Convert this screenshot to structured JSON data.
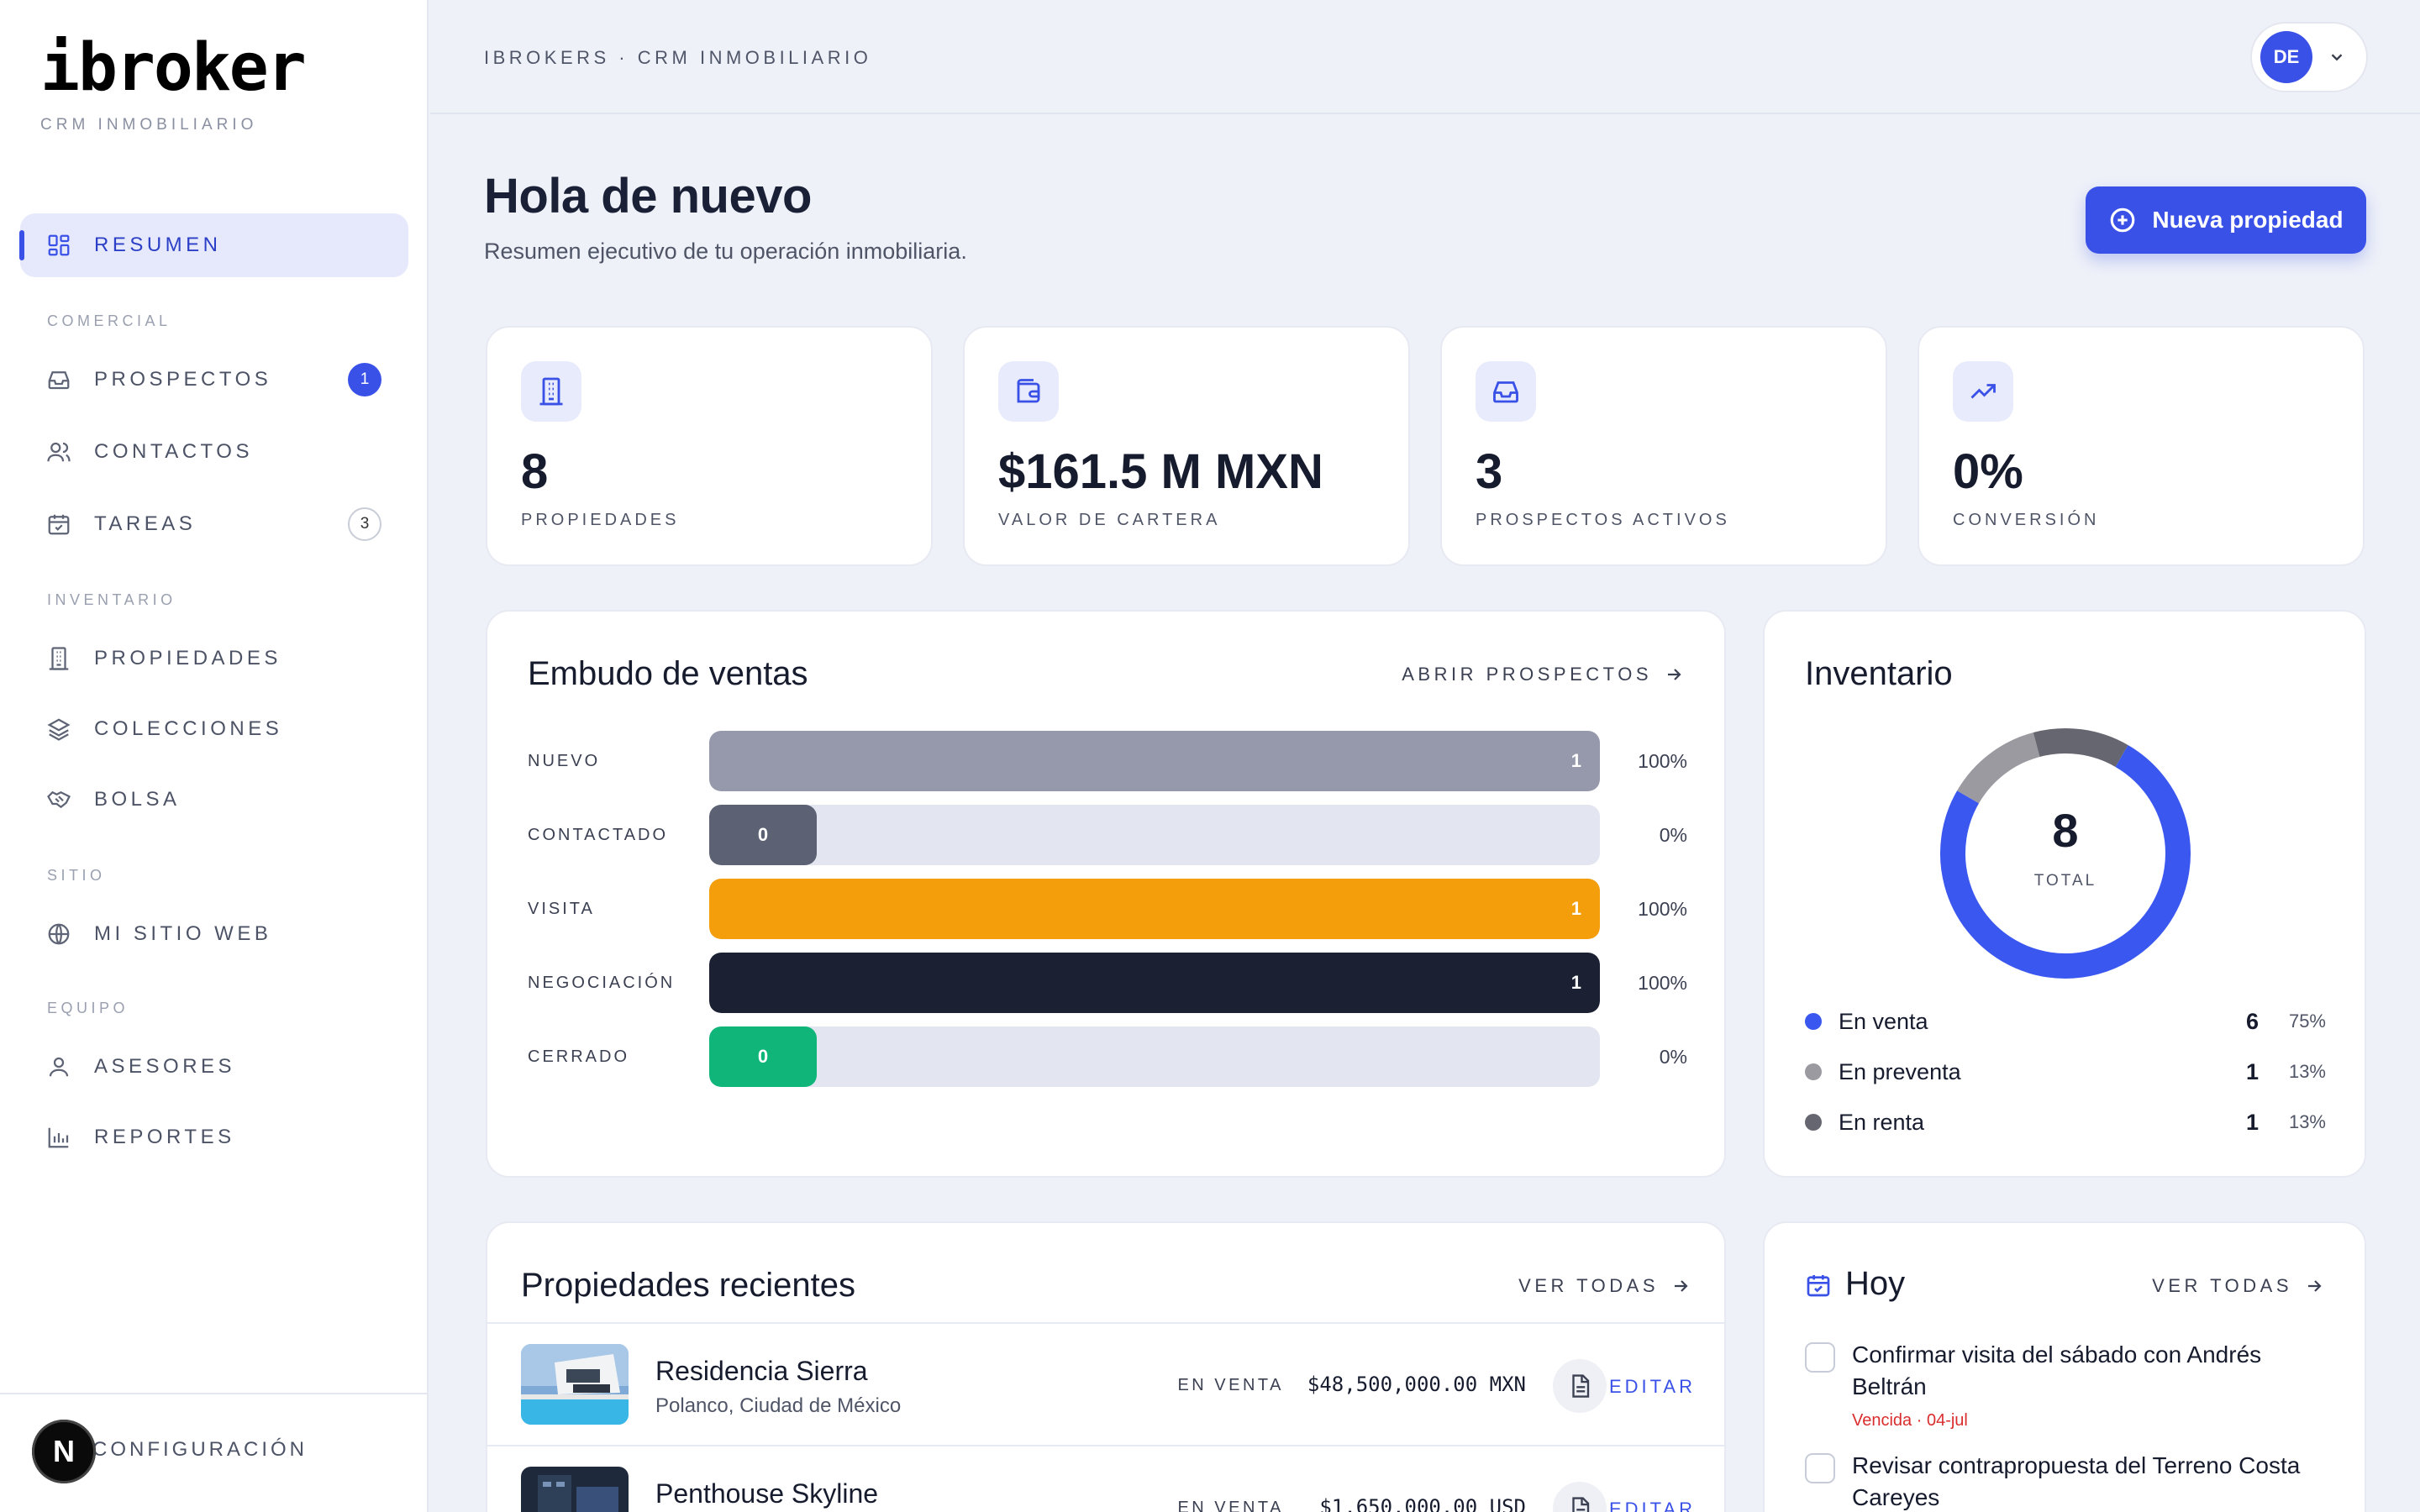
{
  "brand": {
    "logo": "ibroker",
    "subtitle": "CRM INMOBILIARIO"
  },
  "sidebar": {
    "main": {
      "label": "RESUMEN"
    },
    "sections": [
      {
        "label": "COMERCIAL"
      },
      {
        "label": "INVENTARIO"
      },
      {
        "label": "SITIO"
      },
      {
        "label": "EQUIPO"
      }
    ],
    "items": [
      {
        "label": "PROSPECTOS",
        "badge": "1"
      },
      {
        "label": "CONTACTOS"
      },
      {
        "label": "TAREAS",
        "badge": "3"
      },
      {
        "label": "PROPIEDADES"
      },
      {
        "label": "COLECCIONES"
      },
      {
        "label": "BOLSA"
      },
      {
        "label": "MI SITIO WEB"
      },
      {
        "label": "ASESORES"
      },
      {
        "label": "REPORTES"
      }
    ],
    "config": "CONFIGURACIÓN",
    "next_badge": "N"
  },
  "topbar": {
    "breadcrumb": "IBROKERS · CRM INMOBILIARIO",
    "avatar": "DE"
  },
  "header": {
    "title": "Hola de nuevo",
    "subtitle": "Resumen ejecutivo de tu operación inmobiliaria.",
    "new_button": "Nueva propiedad"
  },
  "stats": [
    {
      "value": "8",
      "label": "PROPIEDADES"
    },
    {
      "value": "$161.5 M MXN",
      "label": "VALOR DE CARTERA"
    },
    {
      "value": "3",
      "label": "PROSPECTOS ACTIVOS"
    },
    {
      "value": "0%",
      "label": "CONVERSIÓN"
    }
  ],
  "funnel": {
    "title": "Embudo de ventas",
    "link": "ABRIR PROSPECTOS",
    "stages": [
      {
        "label": "NUEVO",
        "count": "1",
        "pct": "100%",
        "fraction": 1.0,
        "color": "#9599ab"
      },
      {
        "label": "CONTACTADO",
        "count": "0",
        "pct": "0%",
        "fraction": 0.0,
        "color": "#5c6273"
      },
      {
        "label": "VISITA",
        "count": "1",
        "pct": "100%",
        "fraction": 1.0,
        "color": "#f59e0b"
      },
      {
        "label": "NEGOCIACIÓN",
        "count": "1",
        "pct": "100%",
        "fraction": 1.0,
        "color": "#1b2033"
      },
      {
        "label": "CERRADO",
        "count": "0",
        "pct": "0%",
        "fraction": 0.0,
        "color": "#10b57a"
      }
    ]
  },
  "inventory": {
    "title": "Inventario",
    "total": "8",
    "total_label": "TOTAL",
    "items": [
      {
        "name": "En venta",
        "count": "6",
        "pct": "75%",
        "value": 6,
        "color": "#3a57f0"
      },
      {
        "name": "En preventa",
        "count": "1",
        "pct": "13%",
        "value": 1,
        "color": "#9a9aa0"
      },
      {
        "name": "En renta",
        "count": "1",
        "pct": "13%",
        "value": 1,
        "color": "#666670"
      }
    ]
  },
  "recent": {
    "title": "Propiedades recientes",
    "link": "VER TODAS",
    "items": [
      {
        "name": "Residencia Sierra",
        "location": "Polanco, Ciudad de México",
        "status": "EN VENTA",
        "price": "$48,500,000.00 MXN",
        "edit": "EDITAR"
      },
      {
        "name": "Penthouse Skyline",
        "location": "",
        "status": "EN VENTA",
        "price": "$1,650,000.00 USD",
        "edit": "EDITAR"
      }
    ]
  },
  "today": {
    "title": "Hoy",
    "link": "VER TODAS",
    "tasks": [
      {
        "text": "Confirmar visita del sábado con Andrés Beltrán",
        "due": "Vencida · 04-jul"
      },
      {
        "text": "Revisar contrapropuesta del Terreno Costa Careyes",
        "due": ""
      }
    ]
  },
  "colors": {
    "accent": "#3a51e8",
    "background": "#eef1f8",
    "danger": "#d92d2d"
  }
}
